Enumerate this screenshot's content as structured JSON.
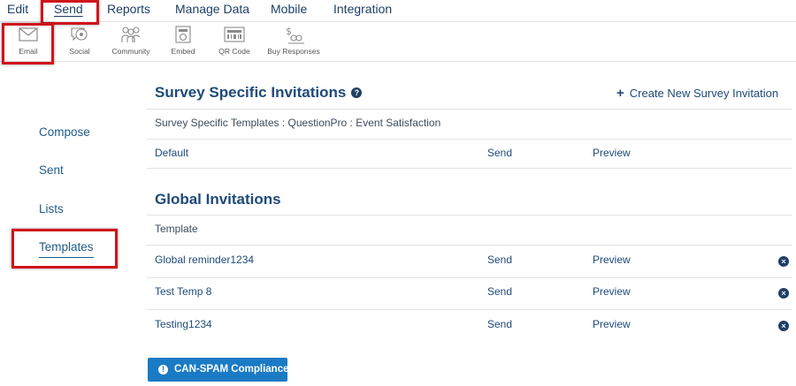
{
  "topnav": {
    "edit": "Edit",
    "send": "Send",
    "reports": "Reports",
    "manage_data": "Manage Data",
    "mobile": "Mobile",
    "integration": "Integration"
  },
  "toolbar": {
    "email": "Email",
    "social": "Social",
    "community": "Community",
    "embed": "Embed",
    "qr_code": "QR Code",
    "buy_responses": "Buy Responses"
  },
  "sidebar": {
    "compose": "Compose",
    "sent": "Sent",
    "lists": "Lists",
    "templates": "Templates"
  },
  "survey_specific": {
    "title": "Survey Specific Invitations",
    "help_icon": "?",
    "create_label": "Create New Survey Invitation",
    "templates_caption": "Survey Specific Templates : QuestionPro : Event Satisfaction",
    "rows": [
      {
        "name": "Default",
        "send": "Send",
        "preview": "Preview"
      }
    ]
  },
  "global": {
    "title": "Global Invitations",
    "column_header": "Template",
    "rows": [
      {
        "name": "Global reminder1234",
        "send": "Send",
        "preview": "Preview"
      },
      {
        "name": "Test Temp 8",
        "send": "Send",
        "preview": "Preview"
      },
      {
        "name": "Testing1234",
        "send": "Send",
        "preview": "Preview"
      }
    ]
  },
  "can_spam": {
    "label": "CAN-SPAM Compliance",
    "icon_glyph": "!"
  },
  "colors": {
    "highlight_red": "#d1141b",
    "link_blue": "#1e4a7a",
    "button_blue": "#1a7bc4"
  }
}
